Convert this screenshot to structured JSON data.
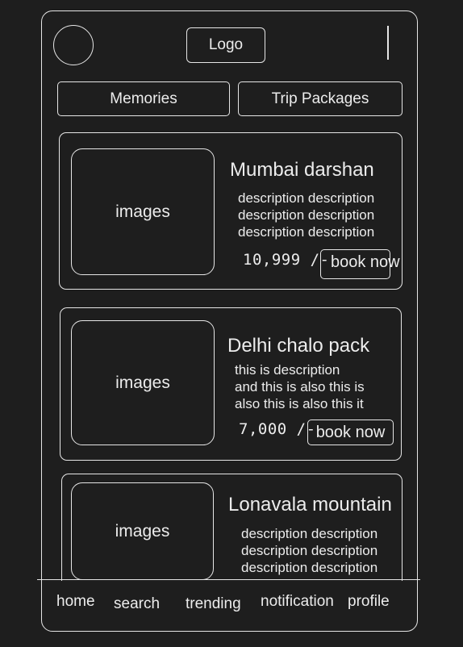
{
  "header": {
    "logo_label": "Logo"
  },
  "tabs": [
    {
      "label": "Memories"
    },
    {
      "label": "Trip Packages"
    }
  ],
  "packages": [
    {
      "image_label": "images",
      "title": "Mumbai darshan",
      "description_lines": [
        "description description",
        "description description",
        "description description"
      ],
      "price": "10,999 /-",
      "book_label": "book now"
    },
    {
      "image_label": "images",
      "title": "Delhi chalo pack",
      "description_lines": [
        "this is description",
        "and this is also this is",
        "also this is also this it"
      ],
      "price": "7,000 /-",
      "book_label": "book now"
    },
    {
      "image_label": "images",
      "title": "Lonavala mountain",
      "description_lines": [
        "description description",
        "description description",
        "description description"
      ]
    }
  ],
  "bottom_nav": [
    {
      "label": "home"
    },
    {
      "label": "search"
    },
    {
      "label": "trending"
    },
    {
      "label": "notification"
    },
    {
      "label": "profile"
    }
  ]
}
